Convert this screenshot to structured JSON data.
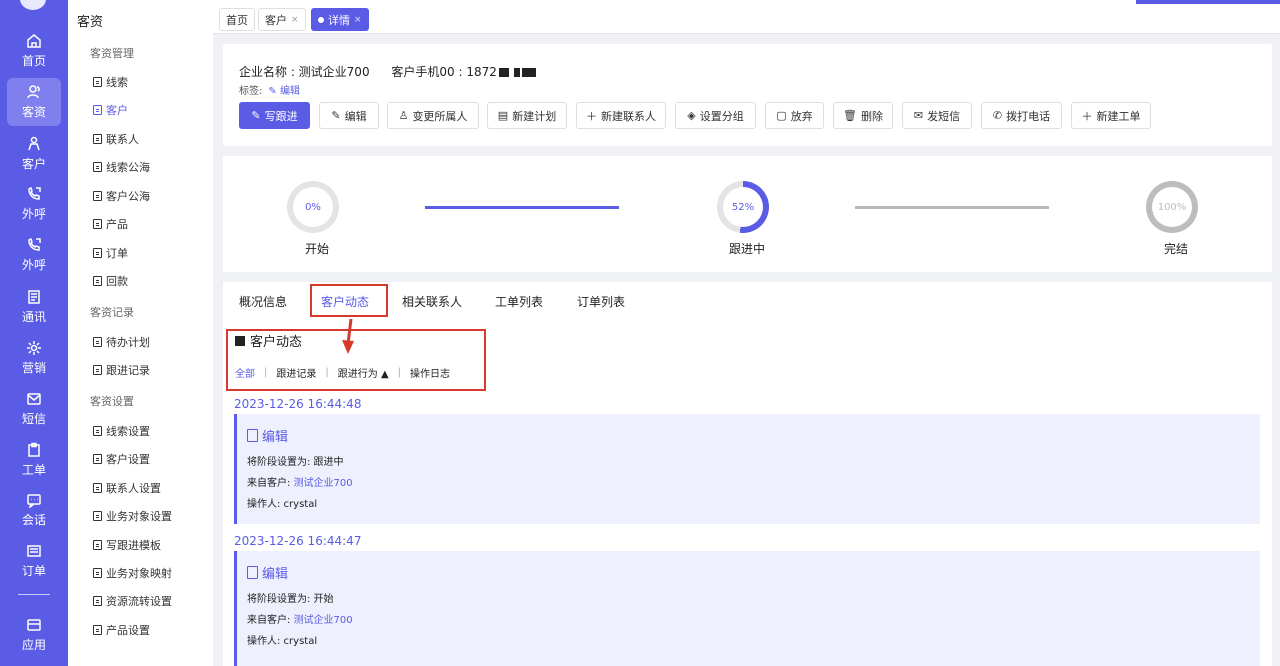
{
  "rail": {
    "items": [
      {
        "label": "首页",
        "icon": "home-icon"
      },
      {
        "label": "客资",
        "icon": "users-icon",
        "active": true
      },
      {
        "label": "客户",
        "icon": "person-icon"
      },
      {
        "label": "外呼",
        "icon": "phone-out-icon"
      },
      {
        "label": "外呼",
        "icon": "phone-out-icon"
      },
      {
        "label": "通讯",
        "icon": "contacts-icon"
      },
      {
        "label": "营销",
        "icon": "marketing-icon"
      },
      {
        "label": "短信",
        "icon": "message-icon"
      },
      {
        "label": "工单",
        "icon": "clipboard-icon"
      },
      {
        "label": "会话",
        "icon": "chat-icon"
      },
      {
        "label": "订单",
        "icon": "list-icon"
      },
      {
        "label": "应用",
        "icon": "app-icon"
      }
    ]
  },
  "sidebar": {
    "title": "客资",
    "groups": [
      {
        "label": "客资管理",
        "items": [
          "线索",
          "客户",
          "联系人",
          "线索公海",
          "客户公海",
          "产品",
          "订单",
          "回款"
        ]
      },
      {
        "label": "客资记录",
        "items": [
          "待办计划",
          "跟进记录"
        ]
      },
      {
        "label": "客资设置",
        "items": [
          "线索设置",
          "客户设置",
          "联系人设置",
          "业务对象设置",
          "写跟进模板",
          "业务对象映射",
          "资源流转设置",
          "产品设置"
        ]
      }
    ],
    "active_item": "客户"
  },
  "page_tabs": [
    {
      "label": "首页"
    },
    {
      "label": "客户",
      "close": "×"
    },
    {
      "label": "详情",
      "close": "×",
      "active": true
    }
  ],
  "info": {
    "company_label": "企业名称 : 测试企业700",
    "phone_label": "客户手机00 : 1872",
    "tags_label": "标签:",
    "tags_edit": "编辑",
    "buttons": [
      "写跟进",
      "编辑",
      "变更所属人",
      "新建计划",
      "新建联系人",
      "设置分组",
      "放弃",
      "删除",
      "发短信",
      "拨打电话",
      "新建工单"
    ]
  },
  "progress": {
    "stages": [
      {
        "label": "开始",
        "percent_text": "0%",
        "percent": 0
      },
      {
        "label": "跟进中",
        "percent_text": "52%",
        "percent": 52
      },
      {
        "label": "完结",
        "percent_text": "100%",
        "percent": 100
      }
    ],
    "accent": "#5b5ce6"
  },
  "detail_tabs": [
    "概况信息",
    "客户动态",
    "相关联系人",
    "工单列表",
    "订单列表"
  ],
  "activity": {
    "title": "客户动态",
    "filters": [
      "全部",
      "跟进记录",
      "跟进行为",
      "操作日志"
    ],
    "entries": [
      {
        "time": "2023-12-26 16:44:48",
        "action": "编辑",
        "line1": "将阶段设置为: 跟进中",
        "from_label": "来自客户:",
        "from_value": "测试企业700",
        "operator": "操作人: crystal"
      },
      {
        "time": "2023-12-26 16:44:47",
        "action": "编辑",
        "line1": "将阶段设置为: 开始",
        "from_label": "来自客户:",
        "from_value": "测试企业700",
        "operator": "操作人: crystal"
      }
    ]
  }
}
